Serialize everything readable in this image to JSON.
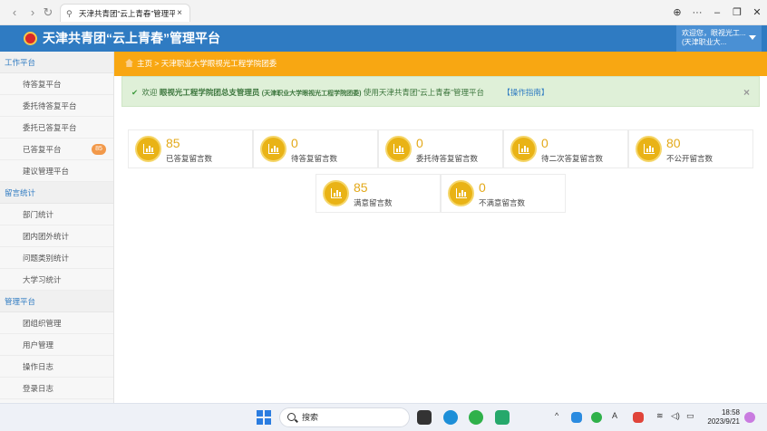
{
  "browser": {
    "tab_title": "天津共青团“云上青春”管理平台",
    "tab_close": "×",
    "back": "‹",
    "forward": "›",
    "reload": "↻",
    "globe": "⊕",
    "more": "···",
    "minimize": "–",
    "restore": "❐",
    "close": "✕"
  },
  "header": {
    "title": "天津共青团“云上青春”管理平台",
    "user_line1": "欢迎您，眼视光工...",
    "user_line2": "(天津职业大..."
  },
  "sidebar": {
    "groups": [
      {
        "label": "工作平台",
        "items": [
          {
            "label": "待答复平台"
          },
          {
            "label": "委托待答复平台"
          },
          {
            "label": "委托已答复平台"
          },
          {
            "label": "已答复平台",
            "badge": "85"
          },
          {
            "label": "建议管理平台"
          }
        ]
      },
      {
        "label": "留言统计",
        "items": [
          {
            "label": "部门统计"
          },
          {
            "label": "团内团外统计"
          },
          {
            "label": "问题类别统计"
          },
          {
            "label": "大学习统计"
          }
        ]
      },
      {
        "label": "管理平台",
        "items": [
          {
            "label": "团组织管理"
          },
          {
            "label": "用户管理"
          },
          {
            "label": "操作日志"
          },
          {
            "label": "登录日志"
          }
        ]
      }
    ]
  },
  "breadcrumb": {
    "home": "主页",
    "separator": ">",
    "current": "天津职业大学眼视光工程学院团委"
  },
  "alert": {
    "check": "✔",
    "welcome": "欢迎",
    "org": "眼视光工程学院团总支管理员",
    "org_parent": "(天津职业大学眼视光工程学院团委)",
    "text": "使用天津共青团“云上青春”管理平台",
    "guide": "【操作指南】",
    "close": "×"
  },
  "stats": [
    {
      "value": "85",
      "label": "已答复留言数"
    },
    {
      "value": "0",
      "label": "待答复留言数"
    },
    {
      "value": "0",
      "label": "委托待答复留言数"
    },
    {
      "value": "0",
      "label": "待二次答复留言数"
    },
    {
      "value": "80",
      "label": "不公开留言数"
    },
    {
      "value": "85",
      "label": "满意留言数"
    },
    {
      "value": "0",
      "label": "不满意留言数"
    }
  ],
  "taskbar": {
    "search_placeholder": "搜索",
    "caret": "^",
    "ime": "英",
    "time": "18:58",
    "date": "2023/9/21"
  },
  "colors": {
    "header_blue": "#2f7bc2",
    "breadcrumb_orange": "#f8a712",
    "alert_green": "#dff0d8",
    "stat_gold": "#e3a91a"
  }
}
